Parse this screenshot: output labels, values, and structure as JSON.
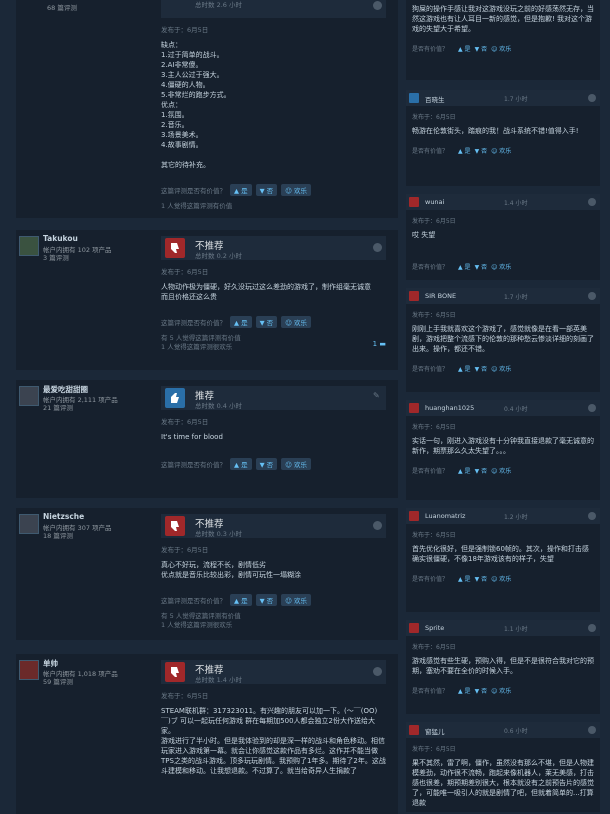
{
  "left": {
    "r0": {
      "meta2": "68 篇评测",
      "hours": "总时数 2.6 小时",
      "posted": "发布于：6月5日",
      "body": "缺点：\n1.过于简单的战斗。\n2.AI非常傻。\n3.主人公过于强大。\n4.僵硬的人物。\n5.非常烂的跑步方式。\n优点：\n1.氛围。\n2.音乐。\n3.场景美术。\n4.故事剧情。\n\n其它的待补充。",
      "helpful_q": "这篇评测是否有价值？",
      "yes": "是",
      "no": "否",
      "funny": "欢乐",
      "footnote": "1 人觉得这篇评测有价值"
    },
    "r1": {
      "name": "Takukou",
      "meta": "帐户内拥有 102 项产品",
      "meta2": "3 篇评测",
      "verdict": "不推荐",
      "hours": "总时数 0.2 小时",
      "posted": "发布于：6月5日",
      "body": "人物动作极为僵硬，好久没玩过这么差劲的游戏了，制作组毫无诚意\n而且价格还这么贵",
      "helpful_q": "这篇评测是否有价值？",
      "yes": "是",
      "no": "否",
      "funny": "欢乐",
      "footnote1": "有 5 人觉得这篇评测有价值",
      "footnote2": "1 人觉得这篇评测很欢乐",
      "comments": "1"
    },
    "r2": {
      "name": "最爱吃甜甜圈",
      "meta": "帐户内拥有 2,111 项产品",
      "meta2": "21 篇评测",
      "verdict": "推荐",
      "hours": "总时数 0.4 小时",
      "posted": "发布于：6月5日",
      "body": "It's time for blood",
      "helpful_q": "这篇评测是否有价值？",
      "yes": "是",
      "no": "否",
      "funny": "欢乐"
    },
    "r3": {
      "name": "Nietzsche",
      "meta": "帐户内拥有 307 项产品",
      "meta2": "18 篇评测",
      "verdict": "不推荐",
      "hours": "总时数 0.3 小时",
      "posted": "发布于：6月5日",
      "body": "真心不好玩，流程不长，剧情低劣\n优点就是音乐比较出彩，剧情可玩性一塌糊涂",
      "helpful_q": "这篇评测是否有价值？",
      "yes": "是",
      "no": "否",
      "funny": "欢乐",
      "footnote1": "有 5 人觉得这篇评测有价值",
      "footnote2": "1 人觉得这篇评测很欢乐"
    },
    "r4": {
      "name": "单帅",
      "meta": "帐户内拥有 1,018 项产品",
      "meta2": "59 篇评测",
      "verdict": "不推荐",
      "hours": "总时数 1.4 小时",
      "posted": "发布于：6月5日",
      "body": "STEAM联机群：317323011。有兴趣的朋友可以加一下。(～￣(OO)￣)ブ 可以一起玩任何游戏 群在每期加500人都会独立2份大作送给大家。\n游戏进行了半小时。但是我体验到的却是深一样的战斗和角色移动。相信玩家进入游戏第一幕。就会让你感觉这款作品有多烂。这作并不能当做TPS之类的战斗游戏。顶多玩玩剧情。我预购了1年多。期待了2年。这战斗建模和移动。让我想退款。不过算了。就当给奇异人生捐款了"
    }
  },
  "right": {
    "c0": {
      "body": "狗屎的操作手感让我对这游戏没玩之前的好感荡然无存，当然这游戏也有让人耳目一新的感觉，但是抱歉! 我对这个游戏的失望大于希望。",
      "helpful_q": "是否有价值？",
      "yes": "是",
      "no": "否",
      "funny": "欢乐"
    },
    "c1": {
      "name": "百晓生",
      "hours": "1.7 小时",
      "posted": "发布于：6月5日",
      "body": "畅游在伦敦街头，踏痕的我！战斗系统不错!值得入手!",
      "helpful_q": "是否有价值？",
      "yes": "是",
      "no": "否",
      "funny": "欢乐"
    },
    "c2": {
      "name": "wunai",
      "hours": "1.4 小时",
      "posted": "发布于：6月5日",
      "body": "哎 失望",
      "helpful_q": "是否有价值？",
      "yes": "是",
      "no": "否",
      "funny": "欢乐"
    },
    "c3": {
      "name": "SIR BONE",
      "hours": "1.7 小时",
      "posted": "发布于：6月5日",
      "body": "刚刚上手我就喜欢这个游戏了，感觉就像是在看一部英美剧，游戏把整个流感下的伦敦的那种愁云惨淡详细的刻画了出来。操作，都还不错。",
      "helpful_q": "是否有价值？",
      "yes": "是",
      "no": "否",
      "funny": "欢乐"
    },
    "c4": {
      "name": "huanghan1025",
      "hours": "0.4 小时",
      "posted": "发布于：6月5日",
      "body": "实话一句，刚进入游戏没有十分钟我直接退款了毫无诚意的新作，期票那么久太失望了。。。",
      "helpful_q": "是否有价值？",
      "yes": "是",
      "no": "否",
      "funny": "欢乐"
    },
    "c5": {
      "name": "Luanomatriz",
      "hours": "1.2 小时",
      "posted": "发布于：6月5日",
      "body": "首先优化很好，但是强制锁60帧的。其次，操作和打击感确实很僵硬，不像18年游戏该有的样子，失望",
      "helpful_q": "是否有价值？",
      "yes": "是",
      "no": "否",
      "funny": "欢乐"
    },
    "c6": {
      "name": "Sprite",
      "hours": "1.1 小时",
      "posted": "发布于：6月5日",
      "body": "游戏感觉有些生硬，预购入得，但是不是很符合我对它的预期，塞劝不要在全价的时候入手。",
      "helpful_q": "是否有价值？",
      "yes": "是",
      "no": "否",
      "funny": "欢乐"
    },
    "c7": {
      "name": "窗猛儿",
      "hours": "0.6 小时",
      "posted": "发布于：6月5日",
      "body": "果不其然，雷了啊，僵作，虽然没有那么不堪，但是人物建模差劲，动作很不流畅，跑起来像机器人，莱无美感，打击感也很差，期预期差别很大，根本就没有之前预告片的感觉了，可能唯一吸引人的就是剧情了吧，但就着简单的...打算退款"
    }
  }
}
